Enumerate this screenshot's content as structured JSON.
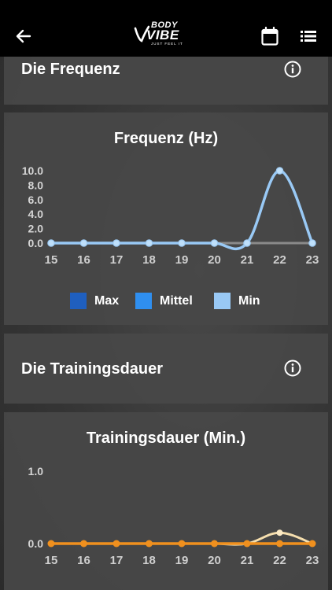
{
  "header": {
    "logo_top": "BODY",
    "logo_main": "VIBE",
    "logo_sub": "JUST FEEL IT",
    "icons": [
      "back-arrow-icon",
      "calendar-icon",
      "list-menu-icon"
    ]
  },
  "sections": {
    "frequency_title": "Die Frequenz",
    "duration_title": "Die Trainingsdauer"
  },
  "colors": {
    "max": "#1f5fbf",
    "mittel": "#2f8ff0",
    "min": "#99c9f5",
    "duration_line": "#f0901e",
    "duration_secondary": "#f6dfae",
    "baseline": "#8a8a8a"
  },
  "chart_data": [
    {
      "type": "line",
      "title": "Frequenz (Hz)",
      "x": [
        15,
        16,
        17,
        18,
        19,
        20,
        21,
        22,
        23
      ],
      "y_ticks": [
        "0.0",
        "2.0",
        "4.0",
        "6.0",
        "8.0",
        "10.0"
      ],
      "ylim": [
        0,
        10
      ],
      "series": [
        {
          "name": "Min",
          "values": [
            0,
            0,
            0,
            0,
            0,
            0,
            0,
            10,
            0
          ]
        }
      ],
      "legend": [
        "Max",
        "Mittel",
        "Min"
      ],
      "legend_placement": "bottom",
      "grid": false
    },
    {
      "type": "line",
      "title": "Trainingsdauer (Min.)",
      "x": [
        15,
        16,
        17,
        18,
        19,
        20,
        21,
        22,
        23
      ],
      "y_ticks": [
        "0.0",
        "1.0"
      ],
      "ylim": [
        0,
        1
      ],
      "series": [
        {
          "values": [
            0,
            0,
            0,
            0,
            0,
            0,
            0,
            0,
            0
          ]
        },
        {
          "values": [
            0,
            0,
            0,
            0,
            0,
            0,
            0,
            0.15,
            0
          ]
        }
      ],
      "grid": false
    }
  ]
}
